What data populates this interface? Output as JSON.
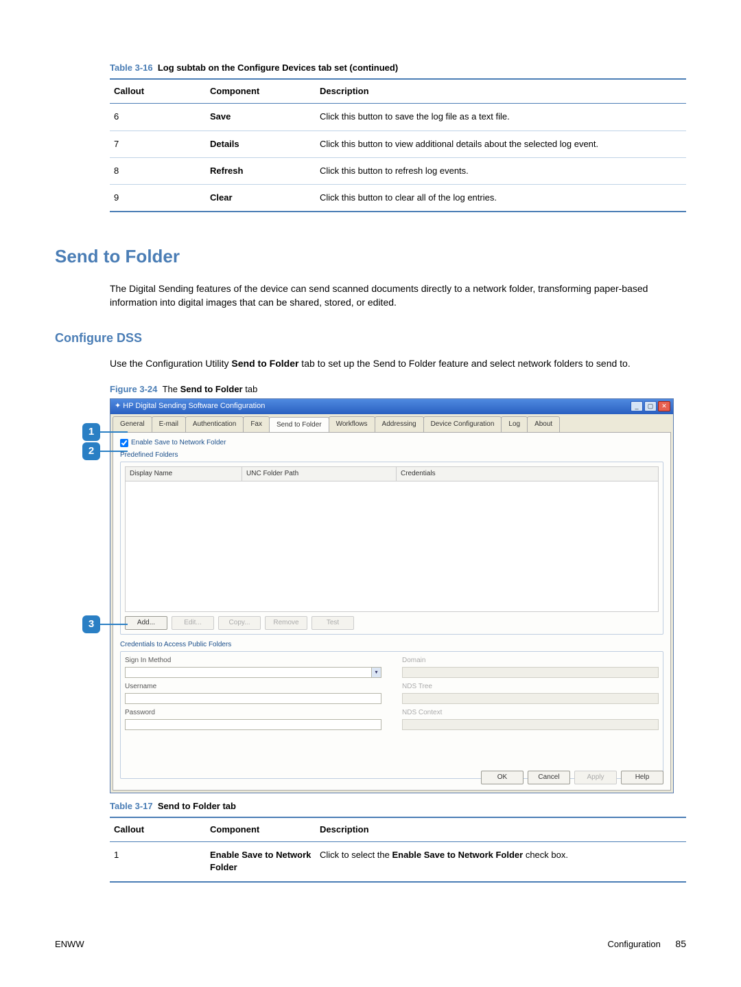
{
  "table316": {
    "caption_prefix": "Table 3-16",
    "caption_title": "Log subtab on the Configure Devices tab set (continued)",
    "headers": {
      "c1": "Callout",
      "c2": "Component",
      "c3": "Description"
    },
    "rows": [
      {
        "callout": "6",
        "component": "Save",
        "desc": "Click this button to save the log file as a text file."
      },
      {
        "callout": "7",
        "component": "Details",
        "desc": "Click this button to view additional details about the selected log event."
      },
      {
        "callout": "8",
        "component": "Refresh",
        "desc": "Click this button to refresh log events."
      },
      {
        "callout": "9",
        "component": "Clear",
        "desc": "Click this button to clear all of the log entries."
      }
    ]
  },
  "headings": {
    "h1": "Send to Folder",
    "h2": "Configure DSS"
  },
  "paragraphs": {
    "p1": "The Digital Sending features of the device can send scanned documents directly to a network folder, transforming paper-based information into digital images that can be shared, stored, or edited.",
    "p2a": "Use the Configuration Utility ",
    "p2b": "Send to Folder",
    "p2c": " tab to set up the Send to Folder feature and select network folders to send to."
  },
  "figure": {
    "prefix": "Figure 3-24",
    "title_a": "The ",
    "title_b": "Send to Folder",
    "title_c": " tab"
  },
  "screenshot": {
    "title": "HP Digital Sending Software Configuration",
    "tabs": [
      "General",
      "E-mail",
      "Authentication",
      "Fax",
      "Send to Folder",
      "Workflows",
      "Addressing",
      "Device Configuration",
      "Log",
      "About"
    ],
    "active_tab_index": 4,
    "enable_checkbox": "Enable Save to Network Folder",
    "group1": "Predefined Folders",
    "list_headers": {
      "a": "Display Name",
      "b": "UNC Folder Path",
      "c": "Credentials"
    },
    "buttons_row": [
      "Add...",
      "Edit...",
      "Copy...",
      "Remove",
      "Test"
    ],
    "buttons_row_enabled": [
      true,
      false,
      false,
      false,
      false
    ],
    "group2": "Credentials to Access Public Folders",
    "cred_fields": {
      "signin": "Sign In Method",
      "domain": "Domain",
      "username": "Username",
      "ndstree": "NDS Tree",
      "password": "Password",
      "ndscontext": "NDS Context"
    },
    "bottom_buttons": [
      "OK",
      "Cancel",
      "Apply",
      "Help"
    ],
    "bottom_buttons_enabled": [
      true,
      true,
      false,
      true
    ],
    "callouts": {
      "c1": "1",
      "c2": "2",
      "c3": "3"
    }
  },
  "table317": {
    "caption_prefix": "Table 3-17",
    "caption_title": "Send to Folder tab",
    "headers": {
      "c1": "Callout",
      "c2": "Component",
      "c3": "Description"
    },
    "row1": {
      "callout": "1",
      "component": "Enable Save to Network Folder",
      "desc_a": "Click to select the ",
      "desc_b": "Enable Save to Network Folder",
      "desc_c": " check box."
    }
  },
  "footer": {
    "left": "ENWW",
    "right_label": "Configuration",
    "page": "85"
  }
}
